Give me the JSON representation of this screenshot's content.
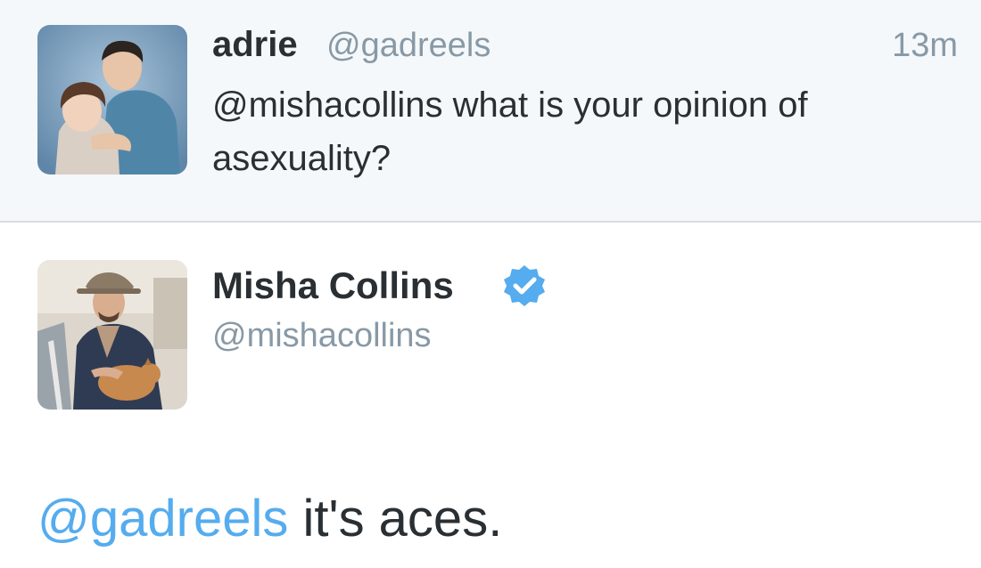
{
  "original_tweet": {
    "author_name": "adrie",
    "author_handle": "@gadreels",
    "timestamp": "13m",
    "text": "@mishacollins what is your opinion of asexuality?"
  },
  "reply_tweet": {
    "author_name": "Misha Collins",
    "author_handle": "@mishacollins",
    "verified_icon": "verified-badge-icon",
    "mention": "@gadreels",
    "text": " it's aces."
  },
  "colors": {
    "mention": "#55acee",
    "handle": "#8899a6",
    "name": "#292f33",
    "top_background": "#f5f8fa",
    "verified": "#55acee"
  }
}
